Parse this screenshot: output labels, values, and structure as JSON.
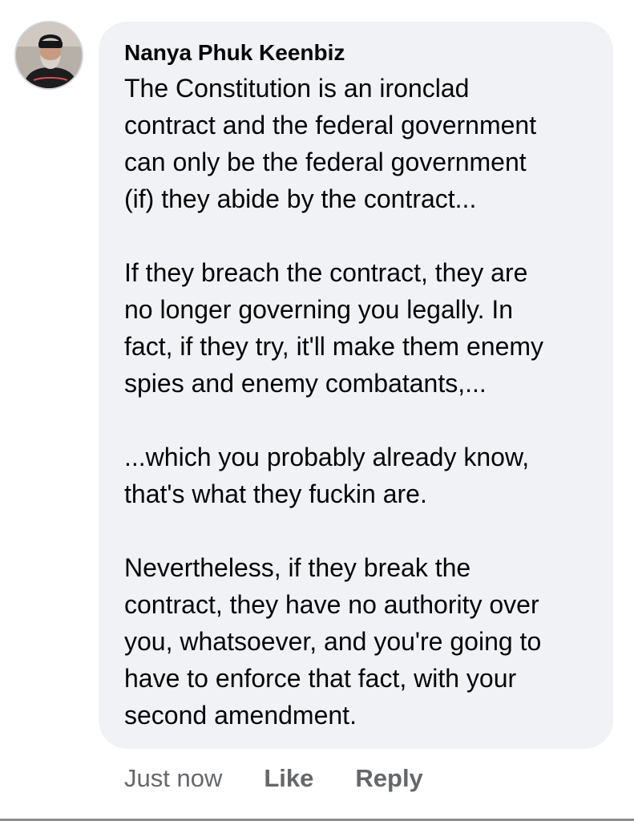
{
  "comment": {
    "author": "Nanya Phuk Keenbiz",
    "avatar_icon": "user-avatar-photo",
    "paragraphs": [
      "The Constitution is an ironclad\ncontract and the federal government\ncan only be the federal government\n(if) they abide by the contract...",
      "If they breach the contract, they are\nno longer governing you legally.  In\nfact, if they try, it'll make them enemy\nspies and enemy combatants,...",
      "...which you probably already know,\nthat's what they fuckin are.",
      "Nevertheless, if they break the\ncontract, they have no authority over\nyou, whatsoever, and you're going to\nhave to enforce that fact, with your\nsecond amendment."
    ],
    "timestamp": "Just now",
    "like_label": "Like",
    "reply_label": "Reply"
  },
  "colors": {
    "bubble_background": "#f0f2f5",
    "text": "#050505",
    "secondary_text": "#65676b"
  }
}
